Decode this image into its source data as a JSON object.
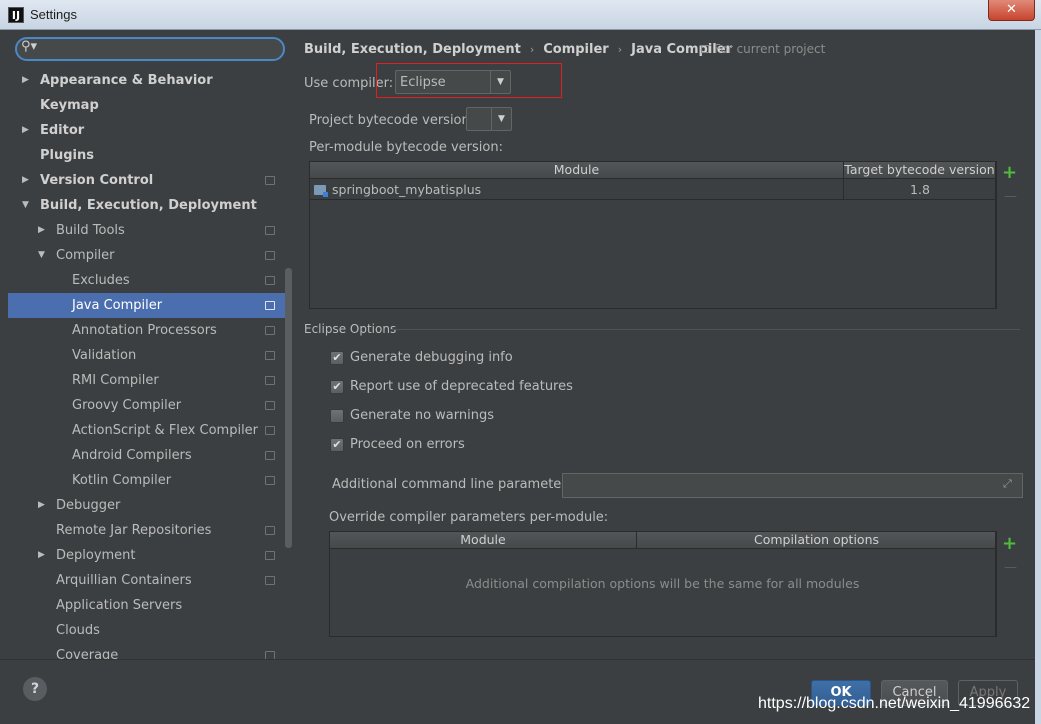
{
  "window": {
    "title": "Settings",
    "app_icon": "IJ",
    "close_glyph": "✕"
  },
  "search": {
    "placeholder": "",
    "value": ""
  },
  "sidebar": {
    "items": [
      {
        "label": "Appearance & Behavior",
        "level": 0,
        "arrow": "▶",
        "bold": true,
        "project": false
      },
      {
        "label": "Keymap",
        "level": 0,
        "arrow": "",
        "bold": true,
        "project": false
      },
      {
        "label": "Editor",
        "level": 0,
        "arrow": "▶",
        "bold": true,
        "project": false
      },
      {
        "label": "Plugins",
        "level": 0,
        "arrow": "",
        "bold": true,
        "project": false
      },
      {
        "label": "Version Control",
        "level": 0,
        "arrow": "▶",
        "bold": true,
        "project": true
      },
      {
        "label": "Build, Execution, Deployment",
        "level": 0,
        "arrow": "▼",
        "bold": true,
        "project": false
      },
      {
        "label": "Build Tools",
        "level": 1,
        "arrow": "▶",
        "bold": false,
        "project": true
      },
      {
        "label": "Compiler",
        "level": 1,
        "arrow": "▼",
        "bold": false,
        "project": true
      },
      {
        "label": "Excludes",
        "level": 2,
        "arrow": "",
        "bold": false,
        "project": true
      },
      {
        "label": "Java Compiler",
        "level": 2,
        "arrow": "",
        "bold": false,
        "project": true,
        "selected": true
      },
      {
        "label": "Annotation Processors",
        "level": 2,
        "arrow": "",
        "bold": false,
        "project": true
      },
      {
        "label": "Validation",
        "level": 2,
        "arrow": "",
        "bold": false,
        "project": true
      },
      {
        "label": "RMI Compiler",
        "level": 2,
        "arrow": "",
        "bold": false,
        "project": true
      },
      {
        "label": "Groovy Compiler",
        "level": 2,
        "arrow": "",
        "bold": false,
        "project": true
      },
      {
        "label": "ActionScript & Flex Compiler",
        "level": 2,
        "arrow": "",
        "bold": false,
        "project": true
      },
      {
        "label": "Android Compilers",
        "level": 2,
        "arrow": "",
        "bold": false,
        "project": true
      },
      {
        "label": "Kotlin Compiler",
        "level": 2,
        "arrow": "",
        "bold": false,
        "project": true
      },
      {
        "label": "Debugger",
        "level": 1,
        "arrow": "▶",
        "bold": false,
        "project": false
      },
      {
        "label": "Remote Jar Repositories",
        "level": 1,
        "arrow": "",
        "bold": false,
        "project": true
      },
      {
        "label": "Deployment",
        "level": 1,
        "arrow": "▶",
        "bold": false,
        "project": true
      },
      {
        "label": "Arquillian Containers",
        "level": 1,
        "arrow": "",
        "bold": false,
        "project": true
      },
      {
        "label": "Application Servers",
        "level": 1,
        "arrow": "",
        "bold": false,
        "project": false
      },
      {
        "label": "Clouds",
        "level": 1,
        "arrow": "",
        "bold": false,
        "project": false
      },
      {
        "label": "Coverage",
        "level": 1,
        "arrow": "",
        "bold": false,
        "project": true
      }
    ]
  },
  "breadcrumb": {
    "items": [
      "Build, Execution, Deployment",
      "Compiler",
      "Java Compiler"
    ],
    "separator": "›",
    "scope": "For current project"
  },
  "compiler": {
    "use_label": "Use compiler:",
    "selected": "Eclipse",
    "bytecode_label": "Project bytecode version:",
    "bytecode_value": "",
    "per_module_label": "Per-module bytecode version:",
    "module_table": {
      "headers": [
        "Module",
        "Target bytecode version"
      ],
      "rows": [
        {
          "module": "springboot_mybatisplus",
          "version": "1.8"
        }
      ]
    }
  },
  "eclipse_options": {
    "title": "Eclipse Options",
    "checkboxes": [
      {
        "label": "Generate debugging info",
        "checked": true
      },
      {
        "label": "Report use of deprecated features",
        "checked": true
      },
      {
        "label": "Generate no warnings",
        "checked": false
      },
      {
        "label": "Proceed on errors",
        "checked": true
      }
    ],
    "additional_label": "Additional command line parameters:",
    "additional_value": "",
    "override_label": "Override compiler parameters per-module:",
    "override_table": {
      "headers": [
        "Module",
        "Compilation options"
      ],
      "empty": "Additional compilation options will be the same for all modules"
    }
  },
  "toolbar": {
    "plus": "+",
    "minus": "—",
    "expand": "⤢"
  },
  "footer": {
    "help": "?",
    "ok": "OK",
    "cancel": "Cancel",
    "apply": "Apply",
    "watermark": "https://blog.csdn.net/weixin_41996632"
  },
  "colors": {
    "accent": "#4b6eaf",
    "background": "#3c3f41",
    "highlight_box": "#e02020",
    "add": "#4fbc3b"
  }
}
